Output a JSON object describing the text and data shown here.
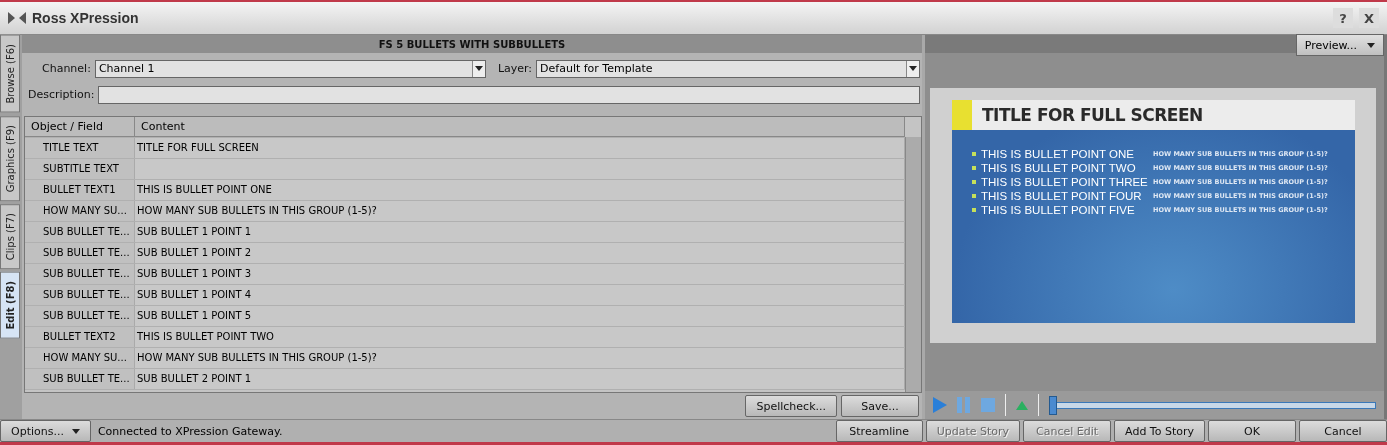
{
  "window": {
    "title": "Ross XPression",
    "buttons": [
      "?",
      "X"
    ]
  },
  "side_tabs": [
    {
      "label": "Browse (F6)",
      "selected": false
    },
    {
      "label": "Graphics (F9)",
      "selected": false
    },
    {
      "label": "Clips (F7)",
      "selected": false
    },
    {
      "label": "Edit (F8)",
      "selected": true
    }
  ],
  "template_title": "FS 5 BULLETS WITH SUBBULLETS",
  "channel": {
    "label": "Channel:",
    "value": "Channel 1"
  },
  "layer": {
    "label": "Layer:",
    "value": "Default for Template"
  },
  "description": {
    "label": "Description:"
  },
  "table": {
    "columns": [
      "Object / Field",
      "Content"
    ],
    "rows": [
      {
        "field": "TITLE TEXT",
        "content": "TITLE FOR FULL SCREEN"
      },
      {
        "field": "SUBTITLE TEXT"
      },
      {
        "field": "BULLET TEXT1",
        "content": "THIS IS BULLET POINT ONE"
      },
      {
        "field": "HOW MANY SU...",
        "content": "HOW MANY SUB BULLETS IN THIS GROUP (1-5)?"
      },
      {
        "field": "SUB BULLET TE...",
        "content": "SUB BULLET 1 POINT 1"
      },
      {
        "field": "SUB BULLET TE...",
        "content": "SUB BULLET 1 POINT 2"
      },
      {
        "field": "SUB BULLET TE...",
        "content": "SUB BULLET 1 POINT 3"
      },
      {
        "field": "SUB BULLET TE...",
        "content": "SUB BULLET 1 POINT 4"
      },
      {
        "field": "SUB BULLET TE...",
        "content": "SUB BULLET 1 POINT 5"
      },
      {
        "field": "BULLET TEXT2",
        "content": "THIS IS BULLET POINT TWO"
      },
      {
        "field": "HOW MANY SU...",
        "content": "HOW MANY SUB BULLETS IN THIS GROUP (1-5)?"
      },
      {
        "field": "SUB BULLET TE...",
        "content": "SUB BULLET 2 POINT 1"
      }
    ]
  },
  "editor_buttons": [
    "Spellcheck...",
    "Save..."
  ],
  "preview": {
    "menu": "Preview...",
    "title": "TITLE FOR FULL SCREEN",
    "bullets": [
      {
        "text": "THIS IS BULLET POINT ONE",
        "note": "HOW MANY SUB BULLETS IN THIS GROUP (1-5)?"
      },
      {
        "text": "THIS IS BULLET POINT TWO",
        "note": "HOW MANY SUB BULLETS IN THIS GROUP (1-5)?"
      },
      {
        "text": "THIS IS BULLET POINT THREE",
        "note": "HOW MANY SUB BULLETS IN THIS GROUP (1-5)?"
      },
      {
        "text": "THIS IS BULLET POINT FOUR",
        "note": "HOW MANY SUB BULLETS IN THIS GROUP (1-5)?"
      },
      {
        "text": "THIS IS BULLET POINT FIVE",
        "note": "HOW MANY SUB BULLETS IN THIS GROUP (1-5)?"
      }
    ],
    "timeline": {
      "level": 0
    }
  },
  "status_bar": {
    "options": "Options...",
    "message": "Connected to XPression Gateway.",
    "buttons": [
      {
        "label": "Streamline",
        "disabled": false
      },
      {
        "label": "Update Story",
        "disabled": true
      },
      {
        "label": "Cancel Edit",
        "disabled": true
      },
      {
        "label": "Add To Story",
        "disabled": false
      },
      {
        "label": "OK",
        "disabled": false
      },
      {
        "label": "Cancel",
        "disabled": false
      }
    ]
  }
}
